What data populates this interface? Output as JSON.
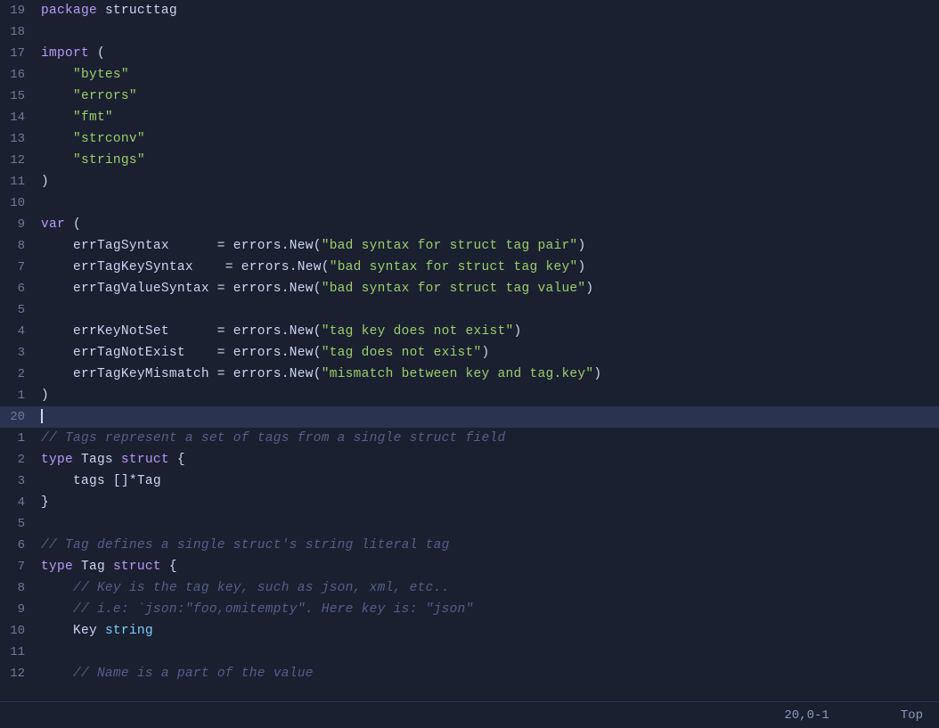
{
  "editor": {
    "background": "#1a2030",
    "status": {
      "position": "20,0-1",
      "scroll": "Top"
    }
  },
  "lines": [
    {
      "num": "19",
      "tokens": [
        {
          "t": "kw",
          "v": "package"
        },
        {
          "t": "plain",
          "v": " structtag"
        }
      ]
    },
    {
      "num": "18",
      "tokens": []
    },
    {
      "num": "17",
      "tokens": [
        {
          "t": "kw",
          "v": "import"
        },
        {
          "t": "plain",
          "v": " ("
        }
      ]
    },
    {
      "num": "16",
      "tokens": [
        {
          "t": "plain",
          "v": "    "
        },
        {
          "t": "str",
          "v": "\"bytes\""
        }
      ]
    },
    {
      "num": "15",
      "tokens": [
        {
          "t": "plain",
          "v": "    "
        },
        {
          "t": "str",
          "v": "\"errors\""
        }
      ]
    },
    {
      "num": "14",
      "tokens": [
        {
          "t": "plain",
          "v": "    "
        },
        {
          "t": "str",
          "v": "\"fmt\""
        }
      ]
    },
    {
      "num": "13",
      "tokens": [
        {
          "t": "plain",
          "v": "    "
        },
        {
          "t": "str",
          "v": "\"strconv\""
        }
      ]
    },
    {
      "num": "12",
      "tokens": [
        {
          "t": "plain",
          "v": "    "
        },
        {
          "t": "str",
          "v": "\"strings\""
        }
      ]
    },
    {
      "num": "11",
      "tokens": [
        {
          "t": "plain",
          "v": ")"
        }
      ]
    },
    {
      "num": "10",
      "tokens": []
    },
    {
      "num": "9",
      "tokens": [
        {
          "t": "kw",
          "v": "var"
        },
        {
          "t": "plain",
          "v": " ("
        }
      ]
    },
    {
      "num": "8",
      "tokens": [
        {
          "t": "plain",
          "v": "    errTagSyntax      = errors.New("
        },
        {
          "t": "str",
          "v": "\"bad syntax for struct tag pair\""
        },
        {
          "t": "plain",
          "v": ")"
        }
      ]
    },
    {
      "num": "7",
      "tokens": [
        {
          "t": "plain",
          "v": "    errTagKeySyntax    = errors.New("
        },
        {
          "t": "str",
          "v": "\"bad syntax for struct tag key\""
        },
        {
          "t": "plain",
          "v": ")"
        }
      ]
    },
    {
      "num": "6",
      "tokens": [
        {
          "t": "plain",
          "v": "    errTagValueSyntax = errors.New("
        },
        {
          "t": "str",
          "v": "\"bad syntax for struct tag value\""
        },
        {
          "t": "plain",
          "v": ")"
        }
      ]
    },
    {
      "num": "5",
      "tokens": []
    },
    {
      "num": "4",
      "tokens": [
        {
          "t": "plain",
          "v": "    errKeyNotSet      = errors.New("
        },
        {
          "t": "str",
          "v": "\"tag key does not exist\""
        },
        {
          "t": "plain",
          "v": ")"
        }
      ]
    },
    {
      "num": "3",
      "tokens": [
        {
          "t": "plain",
          "v": "    errTagNotExist    = errors.New("
        },
        {
          "t": "str",
          "v": "\"tag does not exist\""
        },
        {
          "t": "plain",
          "v": ")"
        }
      ]
    },
    {
      "num": "2",
      "tokens": [
        {
          "t": "plain",
          "v": "    errTagKeyMismatch = errors.New("
        },
        {
          "t": "str",
          "v": "\"mismatch between key and tag.key\""
        },
        {
          "t": "plain",
          "v": ")"
        }
      ]
    },
    {
      "num": "1",
      "tokens": [
        {
          "t": "plain",
          "v": ")"
        }
      ]
    },
    {
      "num": "20",
      "tokens": [],
      "cursor": true
    },
    {
      "num": "1",
      "tokens": [
        {
          "t": "comment",
          "v": "// Tags represent a set of tags from a single struct field"
        }
      ]
    },
    {
      "num": "2",
      "tokens": [
        {
          "t": "kw",
          "v": "type"
        },
        {
          "t": "plain",
          "v": " Tags "
        },
        {
          "t": "kw",
          "v": "struct"
        },
        {
          "t": "plain",
          "v": " {"
        }
      ]
    },
    {
      "num": "3",
      "tokens": [
        {
          "t": "plain",
          "v": "    tags []*Tag"
        }
      ]
    },
    {
      "num": "4",
      "tokens": [
        {
          "t": "plain",
          "v": "}"
        }
      ]
    },
    {
      "num": "5",
      "tokens": []
    },
    {
      "num": "6",
      "tokens": [
        {
          "t": "comment",
          "v": "// Tag defines a single struct's string literal tag"
        }
      ]
    },
    {
      "num": "7",
      "tokens": [
        {
          "t": "kw",
          "v": "type"
        },
        {
          "t": "plain",
          "v": " Tag "
        },
        {
          "t": "kw",
          "v": "struct"
        },
        {
          "t": "plain",
          "v": " {"
        }
      ]
    },
    {
      "num": "8",
      "tokens": [
        {
          "t": "plain",
          "v": "    "
        },
        {
          "t": "comment",
          "v": "// Key is the tag key, such as json, xml, etc.."
        }
      ]
    },
    {
      "num": "9",
      "tokens": [
        {
          "t": "plain",
          "v": "    "
        },
        {
          "t": "comment",
          "v": "// i.e: `json:\"foo,omitempty\". Here key is: \"json\""
        }
      ]
    },
    {
      "num": "10",
      "tokens": [
        {
          "t": "plain",
          "v": "    Key "
        },
        {
          "t": "kw2",
          "v": "string"
        }
      ]
    },
    {
      "num": "11",
      "tokens": []
    },
    {
      "num": "12",
      "tokens": [
        {
          "t": "plain",
          "v": "    "
        },
        {
          "t": "comment",
          "v": "// Name is a part of the value"
        }
      ]
    }
  ]
}
